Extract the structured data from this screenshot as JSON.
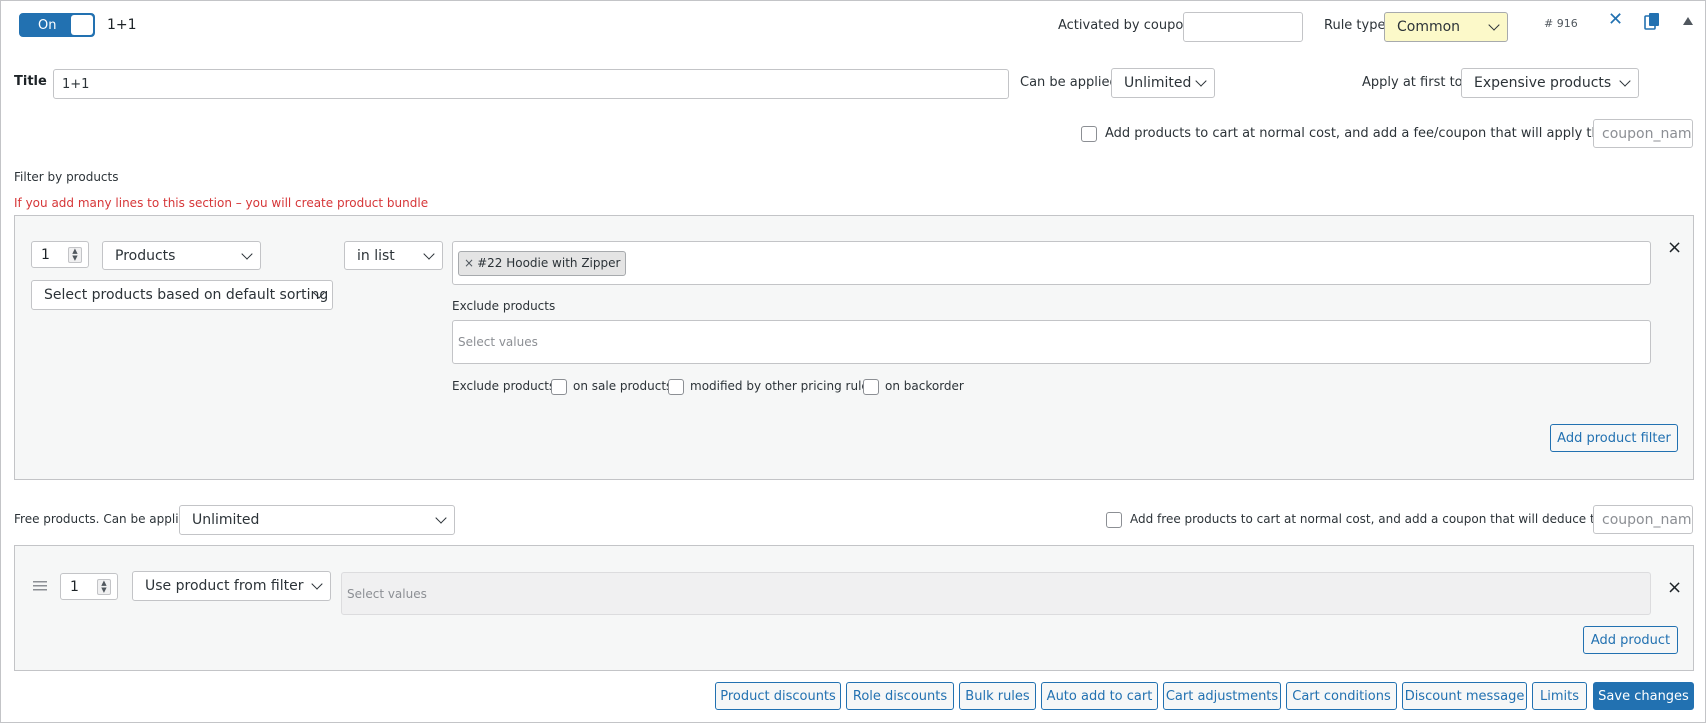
{
  "rule": {
    "toggle_label": "On",
    "name": "1+1",
    "id_label": "# 916"
  },
  "header": {
    "activated_by_coupon_label": "Activated by coupon",
    "activated_by_coupon_value": "",
    "rule_type_label": "Rule type",
    "rule_type_value": "Common"
  },
  "title_row": {
    "title_label": "Title",
    "title_value": "1+1",
    "can_be_applied_label": "Can be applied",
    "can_be_applied_value": "Unlimited",
    "apply_first_label": "Apply at first to:",
    "apply_first_value": "Expensive products"
  },
  "fee_option": {
    "label": "Add products to cart at normal cost, and add a fee/coupon that will apply that cost",
    "coupon_placeholder": "coupon_nam"
  },
  "filter_section": {
    "heading": "Filter by products",
    "warning": "If you add many lines to this section – you will create product bundle",
    "qty": "1",
    "type_value": "Products",
    "sorting_value": "Select products based on default sorting",
    "condition_value": "in list",
    "selected_tag": "#22 Hoodie with Zipper",
    "tag_remove": "×",
    "exclude_label": "Exclude products",
    "exclude_placeholder": "Select values",
    "exclude_options_label": "Exclude products",
    "exclude_on_sale": "on sale products",
    "exclude_modified": "modified by other pricing rules",
    "exclude_backorder": "on backorder",
    "add_filter_button": "Add product filter",
    "remove_icon": "×"
  },
  "free_section": {
    "label": "Free products. Can be applied",
    "applied_value": "Unlimited",
    "coupon_option_label": "Add free products to cart at normal cost, and add a coupon that will deduce that cost",
    "coupon_placeholder": "coupon_nam",
    "qty": "1",
    "product_source_value": "Use product from filter",
    "values_placeholder": "Select values",
    "add_product_button": "Add product",
    "remove_icon": "×"
  },
  "footer": {
    "buttons": [
      "Product discounts",
      "Role discounts",
      "Bulk rules",
      "Auto add to cart",
      "Cart adjustments",
      "Cart conditions",
      "Discount message",
      "Limits"
    ],
    "save_label": "Save changes"
  },
  "icons": {
    "close": "close-icon",
    "copy": "copy-icon",
    "collapse": "collapse-triangle-icon",
    "drag": "drag-handle-icon"
  },
  "colors": {
    "accent": "#2271b1",
    "warning_text": "#d63638",
    "rule_type_bg": "#fcf9c9"
  }
}
